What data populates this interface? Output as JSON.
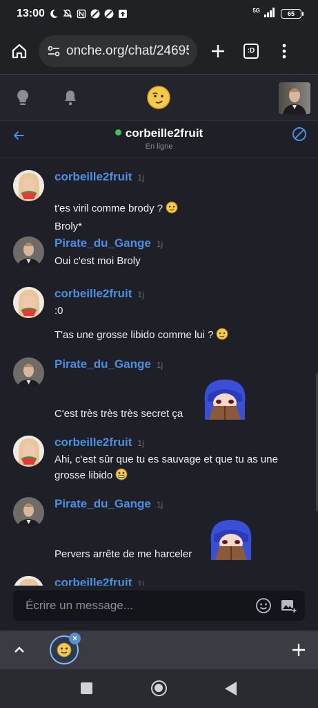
{
  "status_bar": {
    "time": "13:00",
    "network": "5G",
    "battery": "65"
  },
  "browser": {
    "url": "onche.org/chat/24695",
    "tabs_label": ":D"
  },
  "chat": {
    "contact_name": "corbeille2fruit",
    "contact_status": "En ligne",
    "online_color": "#3cc35a"
  },
  "messages": [
    {
      "author": "corbeille2fruit",
      "time": "1j",
      "lines": [
        "t'es viril comme brody ?",
        "Broly*"
      ]
    },
    {
      "author": "Pirate_du_Gange",
      "time": "1j",
      "lines": [
        "Oui c'est moi Broly"
      ]
    },
    {
      "author": "corbeille2fruit",
      "time": "1j",
      "lines": [
        ":0",
        "T'as une grosse libido comme lui ?"
      ]
    },
    {
      "author": "Pirate_du_Gange",
      "time": "1j",
      "lines": [
        "C'est très très très secret ça"
      ]
    },
    {
      "author": "corbeille2fruit",
      "time": "1j",
      "lines": [
        "Ahi, c'est sûr que tu es sauvage et que tu as une",
        "grosse libido"
      ]
    },
    {
      "author": "Pirate_du_Gange",
      "time": "1j",
      "lines": [
        "Pervers arrête de me harceler"
      ]
    },
    {
      "author": "corbeille2fruit",
      "time": "1j",
      "lines": []
    }
  ],
  "composer": {
    "placeholder": "Écrire un message..."
  },
  "colors": {
    "accent": "#4a90e2",
    "background": "#1e1f27"
  }
}
